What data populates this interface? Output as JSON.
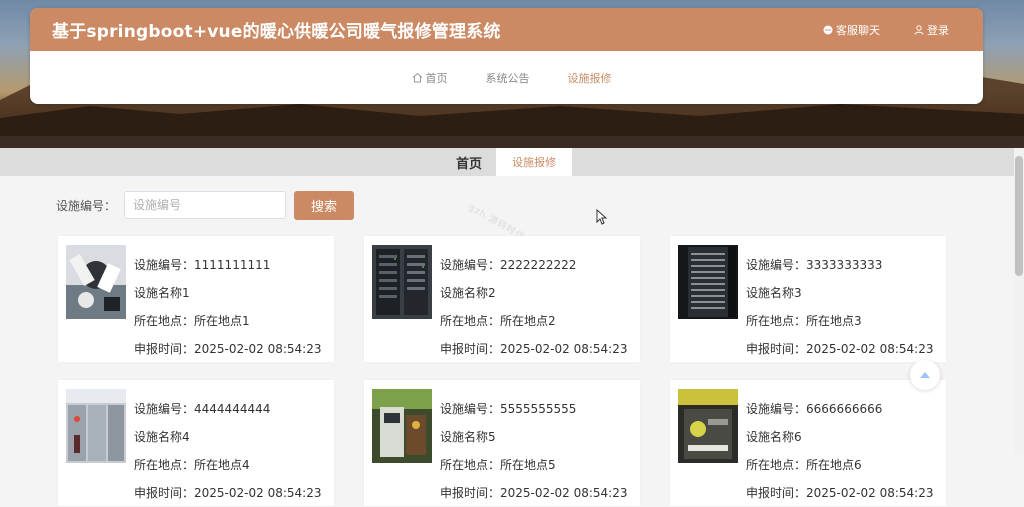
{
  "header": {
    "title": "基于springboot+vue的暖心供暖公司暖气报修管理系统",
    "chat_label": "客服聊天",
    "login_label": "登录"
  },
  "nav": {
    "items": [
      {
        "label": "首页"
      },
      {
        "label": "系统公告"
      },
      {
        "label": "设施报修"
      }
    ],
    "active_index": 2
  },
  "breadcrumb": {
    "home": "首页",
    "current": "设施报修"
  },
  "search": {
    "label": "设施编号：",
    "placeholder": "设施编号",
    "button": "搜索"
  },
  "watermark": "gzh 源码时代",
  "cards": [
    {
      "code_label": "设施编号：",
      "code": "1111111111",
      "name": "设施名称1",
      "loc_label": "所在地点：",
      "location": "所在地点1",
      "time_label": "申报时间：",
      "time": "2025-02-02 08:54:23",
      "thumb": "robot-arm-photo"
    },
    {
      "code_label": "设施编号：",
      "code": "2222222222",
      "name": "设施名称2",
      "loc_label": "所在地点：",
      "location": "所在地点2",
      "time_label": "申报时间：",
      "time": "2025-02-02 08:54:23",
      "thumb": "server-rack-photo"
    },
    {
      "code_label": "设施编号：",
      "code": "3333333333",
      "name": "设施名称3",
      "loc_label": "所在地点：",
      "location": "所在地点3",
      "time_label": "申报时间：",
      "time": "2025-02-02 08:54:23",
      "thumb": "server-rack-photo"
    },
    {
      "code_label": "设施编号：",
      "code": "4444444444",
      "name": "设施名称4",
      "loc_label": "所在地点：",
      "location": "所在地点4",
      "time_label": "申报时间：",
      "time": "2025-02-02 08:54:23",
      "thumb": "switchgear-photo"
    },
    {
      "code_label": "设施编号：",
      "code": "5555555555",
      "name": "设施名称5",
      "loc_label": "所在地点：",
      "location": "所在地点5",
      "time_label": "申报时间：",
      "time": "2025-02-02 08:54:23",
      "thumb": "factory-machine-photo"
    },
    {
      "code_label": "设施编号：",
      "code": "6666666666",
      "name": "设施名称6",
      "loc_label": "所在地点：",
      "location": "所在地点6",
      "time_label": "申报时间：",
      "time": "2025-02-02 08:54:23",
      "thumb": "industrial-robot-photo"
    }
  ],
  "colors": {
    "accent": "#cc8a64",
    "page_bg": "#f4f4f4"
  }
}
